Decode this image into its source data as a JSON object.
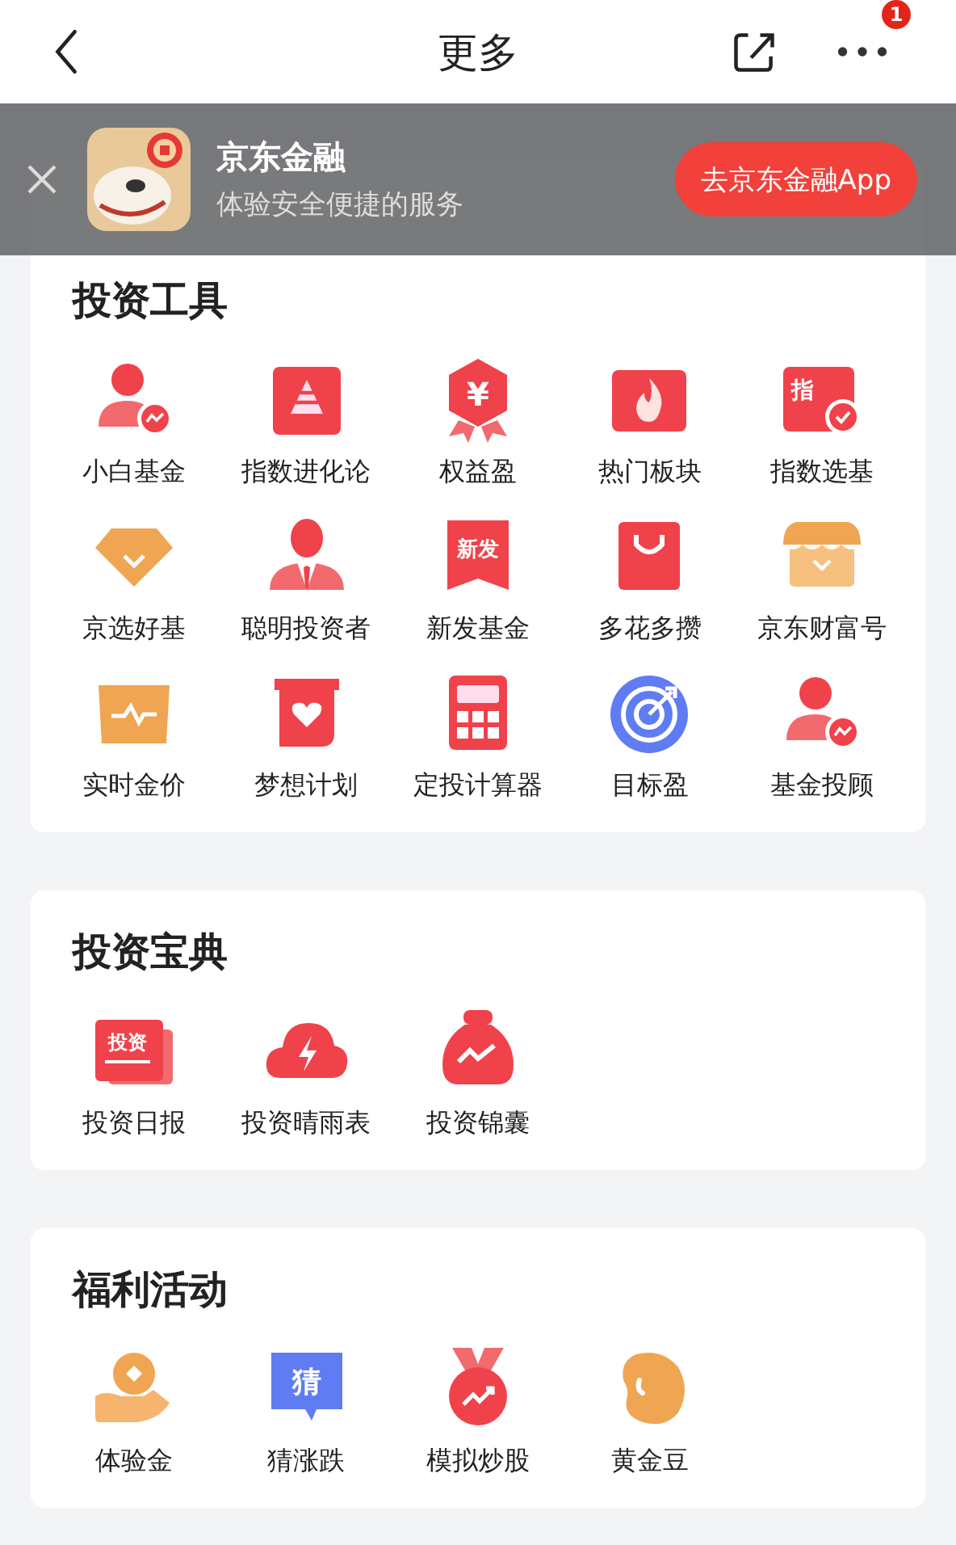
{
  "nav": {
    "title": "更多",
    "badge": "1"
  },
  "banner": {
    "app_name": "京东金融",
    "subtitle": "体验安全便捷的服务",
    "button": "去京东金融App"
  },
  "sections": [
    {
      "title": "投资工具",
      "items": [
        {
          "label": "小白基金",
          "kind": "person-chart"
        },
        {
          "label": "指数进化论",
          "kind": "pyramid"
        },
        {
          "label": "权益盈",
          "kind": "hex-ribbon",
          "icon_text": "¥"
        },
        {
          "label": "热门板块",
          "kind": "flame"
        },
        {
          "label": "指数选基",
          "kind": "card-check",
          "icon_text": "指"
        },
        {
          "label": "京选好基",
          "kind": "diamond"
        },
        {
          "label": "聪明投资者",
          "kind": "businessman"
        },
        {
          "label": "新发基金",
          "kind": "banner-tag",
          "icon_text": "新发"
        },
        {
          "label": "多花多攒",
          "kind": "bag"
        },
        {
          "label": "京东财富号",
          "kind": "shop"
        },
        {
          "label": "实时金价",
          "kind": "wave-box"
        },
        {
          "label": "梦想计划",
          "kind": "heart-box"
        },
        {
          "label": "定投计算器",
          "kind": "calculator"
        },
        {
          "label": "目标盈",
          "kind": "target"
        },
        {
          "label": "基金投顾",
          "kind": "person-chart"
        }
      ]
    },
    {
      "title": "投资宝典",
      "items": [
        {
          "label": "投资日报",
          "kind": "paper",
          "icon_text": "投资"
        },
        {
          "label": "投资晴雨表",
          "kind": "cloud-bolt"
        },
        {
          "label": "投资锦囊",
          "kind": "pouch"
        }
      ]
    },
    {
      "title": "福利活动",
      "items": [
        {
          "label": "体验金",
          "kind": "coin-hand"
        },
        {
          "label": "猜涨跌",
          "kind": "chat",
          "icon_text": "猜"
        },
        {
          "label": "模拟炒股",
          "kind": "medal"
        },
        {
          "label": "黄金豆",
          "kind": "bean"
        }
      ]
    }
  ]
}
